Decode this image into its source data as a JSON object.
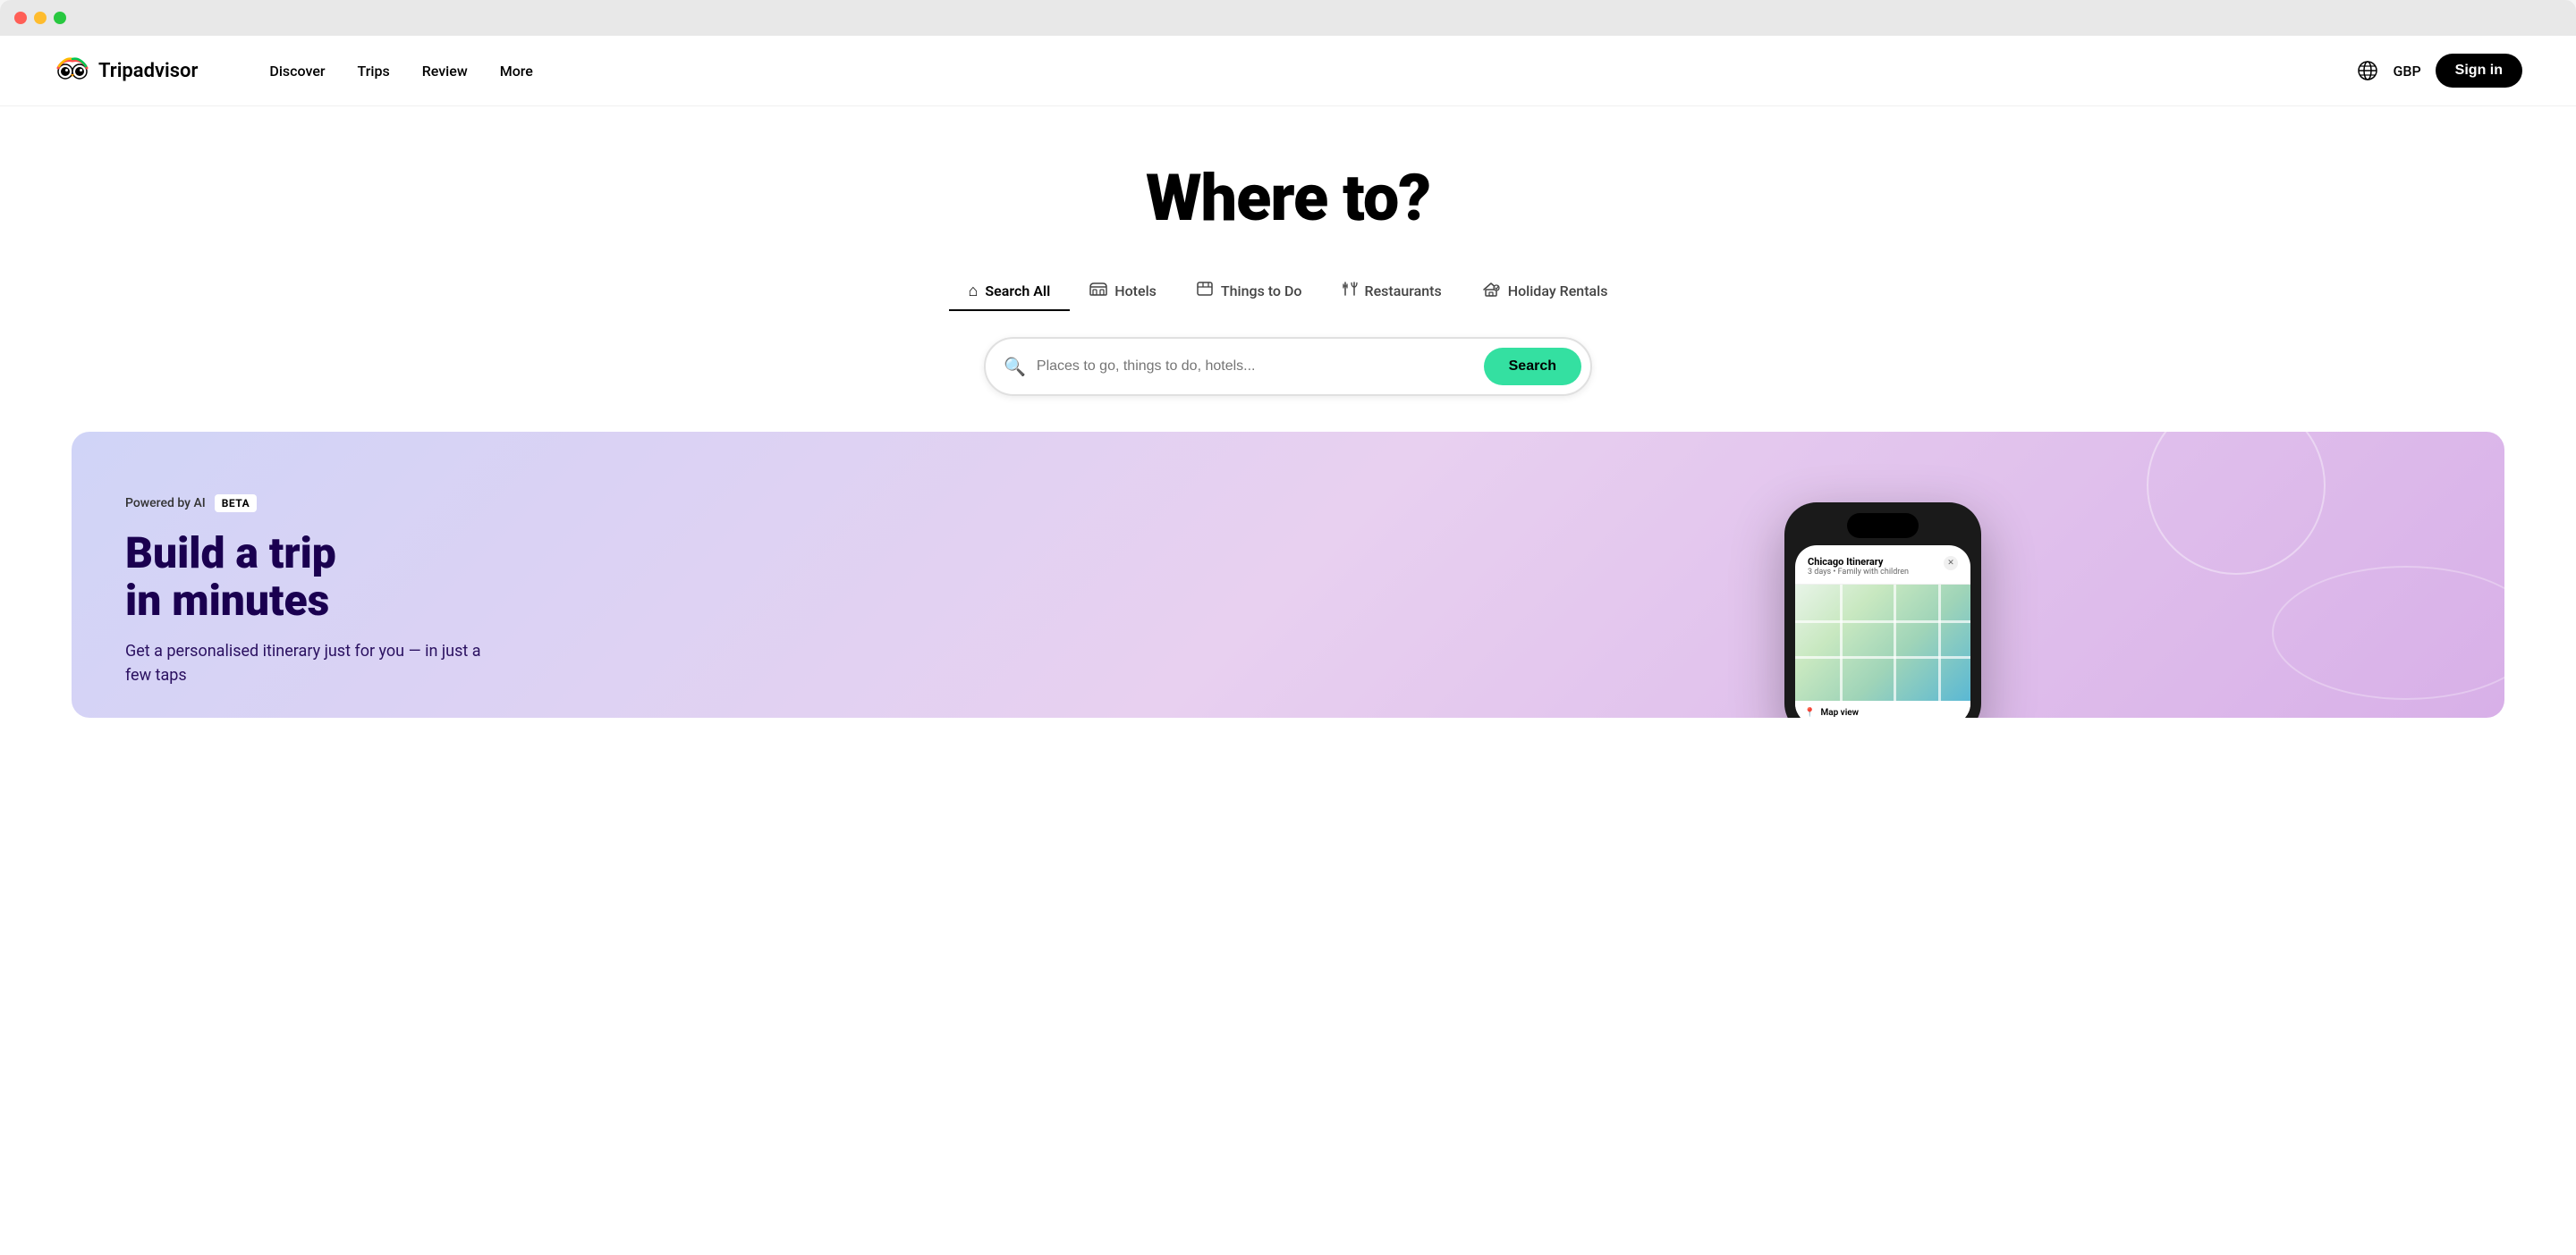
{
  "window": {
    "close_label": "close",
    "minimize_label": "minimize",
    "maximize_label": "maximize"
  },
  "navbar": {
    "logo_text": "Tripadvisor",
    "links": [
      {
        "id": "discover",
        "label": "Discover"
      },
      {
        "id": "trips",
        "label": "Trips"
      },
      {
        "id": "review",
        "label": "Review"
      },
      {
        "id": "more",
        "label": "More"
      }
    ],
    "currency": "GBP",
    "sign_in_label": "Sign in"
  },
  "hero": {
    "title": "Where to?",
    "tabs": [
      {
        "id": "search-all",
        "label": "Search All",
        "icon": "🏠",
        "active": true
      },
      {
        "id": "hotels",
        "label": "Hotels",
        "icon": "🛏",
        "active": false
      },
      {
        "id": "things-to-do",
        "label": "Things to Do",
        "icon": "🎭",
        "active": false
      },
      {
        "id": "restaurants",
        "label": "Restaurants",
        "icon": "🍴",
        "active": false
      },
      {
        "id": "holiday-rentals",
        "label": "Holiday Rentals",
        "icon": "🏡",
        "active": false
      }
    ],
    "search_placeholder": "Places to go, things to do, hotels...",
    "search_button_label": "Search"
  },
  "ai_banner": {
    "powered_by_label": "Powered by AI",
    "beta_label": "BETA",
    "headline_line1": "Build a trip",
    "headline_line2": "in minutes",
    "subtext": "Get a personalised itinerary just for you — in just a few taps",
    "phone": {
      "itinerary_title": "Chicago Itinerary",
      "itinerary_subtitle": "3 days • Family with children",
      "map_view_label": "Map view"
    }
  },
  "colors": {
    "search_btn": "#34e0a1",
    "sign_in_bg": "#000000",
    "active_tab_underline": "#000000",
    "banner_gradient_start": "#d0d4f7",
    "banner_gradient_end": "#d8b0e8",
    "headline_color": "#1a0050"
  }
}
